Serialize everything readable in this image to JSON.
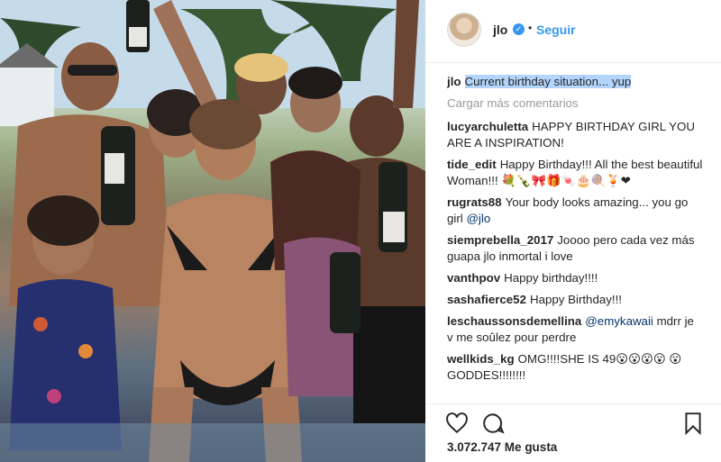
{
  "post": {
    "username": "jlo",
    "follow_label": "Seguir",
    "separator": "•",
    "caption": {
      "user": "jlo",
      "text": "Current birthday situation... yup"
    },
    "load_more": "Cargar más comentarios",
    "likes": "3.072.747 Me gusta"
  },
  "comments": [
    {
      "user": "lucyarchuletta",
      "text": "HAPPY BIRTHDAY GIRL YOU ARE A INSPIRATION!"
    },
    {
      "user": "tide_edit",
      "text": "Happy Birthday!!! All the best beautiful Woman!!! 💐🍾🎀🎁🍬🎂🍭🍹❤"
    },
    {
      "user": "rugrats88",
      "text": "Your body looks amazing... you go girl",
      "mention": "@jlo"
    },
    {
      "user": "siemprebella_2017",
      "text": "Joooo pero cada vez más guapa jlo inmortal i love"
    },
    {
      "user": "vanthpov",
      "text": "Happy birthday!!!!"
    },
    {
      "user": "sashafierce52",
      "text": "Happy Birthday!!!"
    },
    {
      "user": "leschaussonsdemellina",
      "mention": "@emykawaii",
      "text": " mdrr je v me soûlez pour perdre"
    },
    {
      "user": "wellkids_kg",
      "text": "OMG!!!!SHE IS 49😮😮😮😮 😮 GODDES!!!!!!!!"
    }
  ],
  "icons": {
    "avatar": "profile-photo",
    "verified": "verified-badge-icon",
    "like": "heart-outline-icon",
    "comment": "speech-bubble-icon",
    "save": "bookmark-icon"
  },
  "colors": {
    "link": "#3897f0",
    "highlight": "#b3d4fc",
    "muted": "#999999",
    "text": "#262626"
  }
}
